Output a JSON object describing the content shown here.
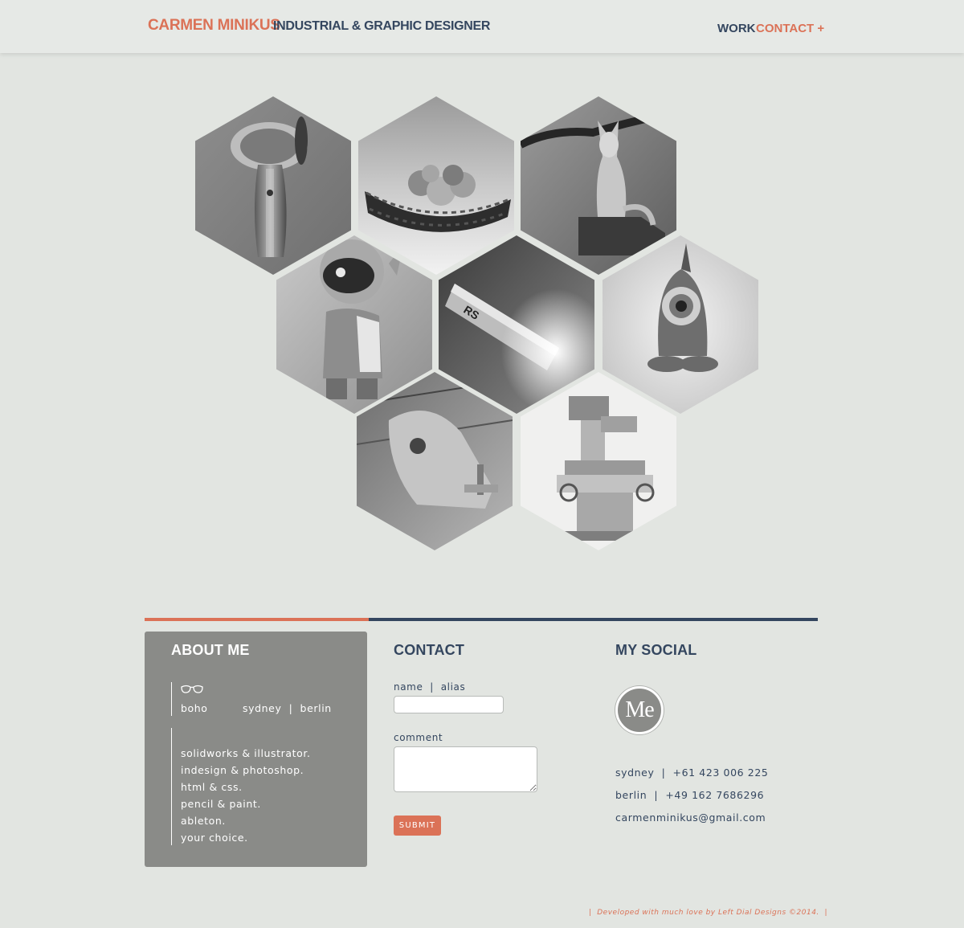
{
  "header": {
    "name": "CARMEN MINIKUS",
    "tagline": "INDUSTRIAL & GRAPHIC DESIGNER",
    "nav": {
      "work": "WORK",
      "contact": "CONTACT +"
    }
  },
  "portfolio": {
    "items": [
      {
        "name": "hand-dryer"
      },
      {
        "name": "fruit-bowl"
      },
      {
        "name": "cat-figurine"
      },
      {
        "name": "astronaut-robot"
      },
      {
        "name": "flashlight"
      },
      {
        "name": "cyclops-figure"
      },
      {
        "name": "tape-dispenser"
      },
      {
        "name": "milling-machine"
      }
    ]
  },
  "about": {
    "title": "ABOUT ME",
    "style": "boho",
    "locations": "sydney  |  berlin",
    "skills": [
      "solidworks & illustrator.",
      "indesign & photoshop.",
      "html & css.",
      "pencil & paint.",
      "ableton.",
      "your choice."
    ]
  },
  "contact": {
    "title": "CONTACT",
    "name_label": "name  |  alias",
    "name_value": "",
    "comment_label": "comment",
    "comment_value": "",
    "submit_label": "SUBMIT"
  },
  "social": {
    "title": "MY SOCIAL",
    "avatar_text": "Me",
    "sydney_phone": "sydney  |  +61 423 006 225",
    "berlin_phone": "berlin  |  +49 162 7686296",
    "email": "carmenminikus@gmail.com"
  },
  "footer": {
    "credit": "|  Developed with much love by Left Dial Designs ©2014.  |"
  },
  "colors": {
    "accent": "#db7257",
    "navy": "#34465f",
    "background": "#e2e5e1",
    "panel": "#8a8b88"
  }
}
